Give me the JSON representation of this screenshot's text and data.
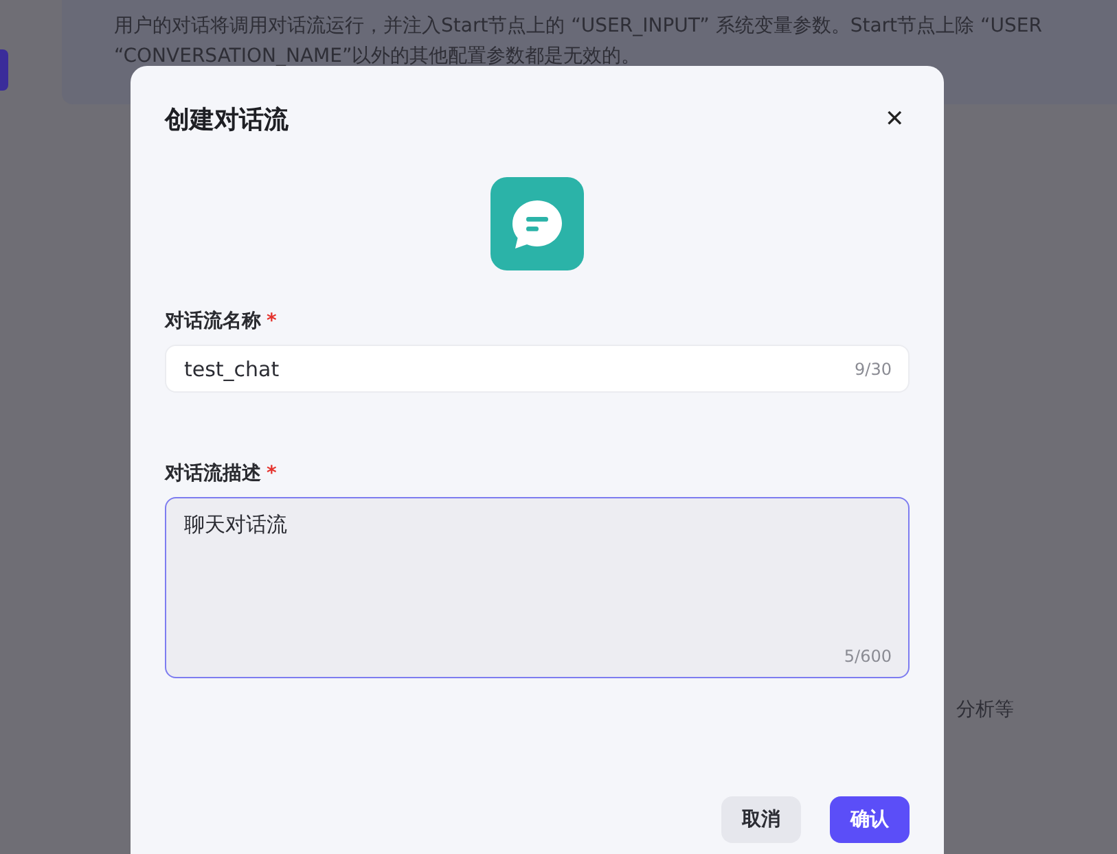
{
  "background": {
    "notice_lines": [
      "用户的对话将调用对话流运行，并注入Start节点上的 “USER_INPUT” 系统变量参数。Start节点上除 “USER",
      "“CONVERSATION_NAME”以外的其他配置参数都是无效的。"
    ],
    "side_text": "分析等"
  },
  "dialog": {
    "title": "创建对话流",
    "close": "✕",
    "fields": [
      {
        "kind": "input",
        "label": "对话流名称",
        "required_mark": "*",
        "value": "test_chat",
        "count": "9/30",
        "focused": false
      },
      {
        "kind": "textarea",
        "label": "对话流描述",
        "required_mark": "*",
        "value": "聊天对话流",
        "count": "5/600",
        "focused": true
      }
    ],
    "buttons": [
      {
        "label": "取消",
        "primary": false
      },
      {
        "label": "确认",
        "primary": true
      }
    ]
  }
}
